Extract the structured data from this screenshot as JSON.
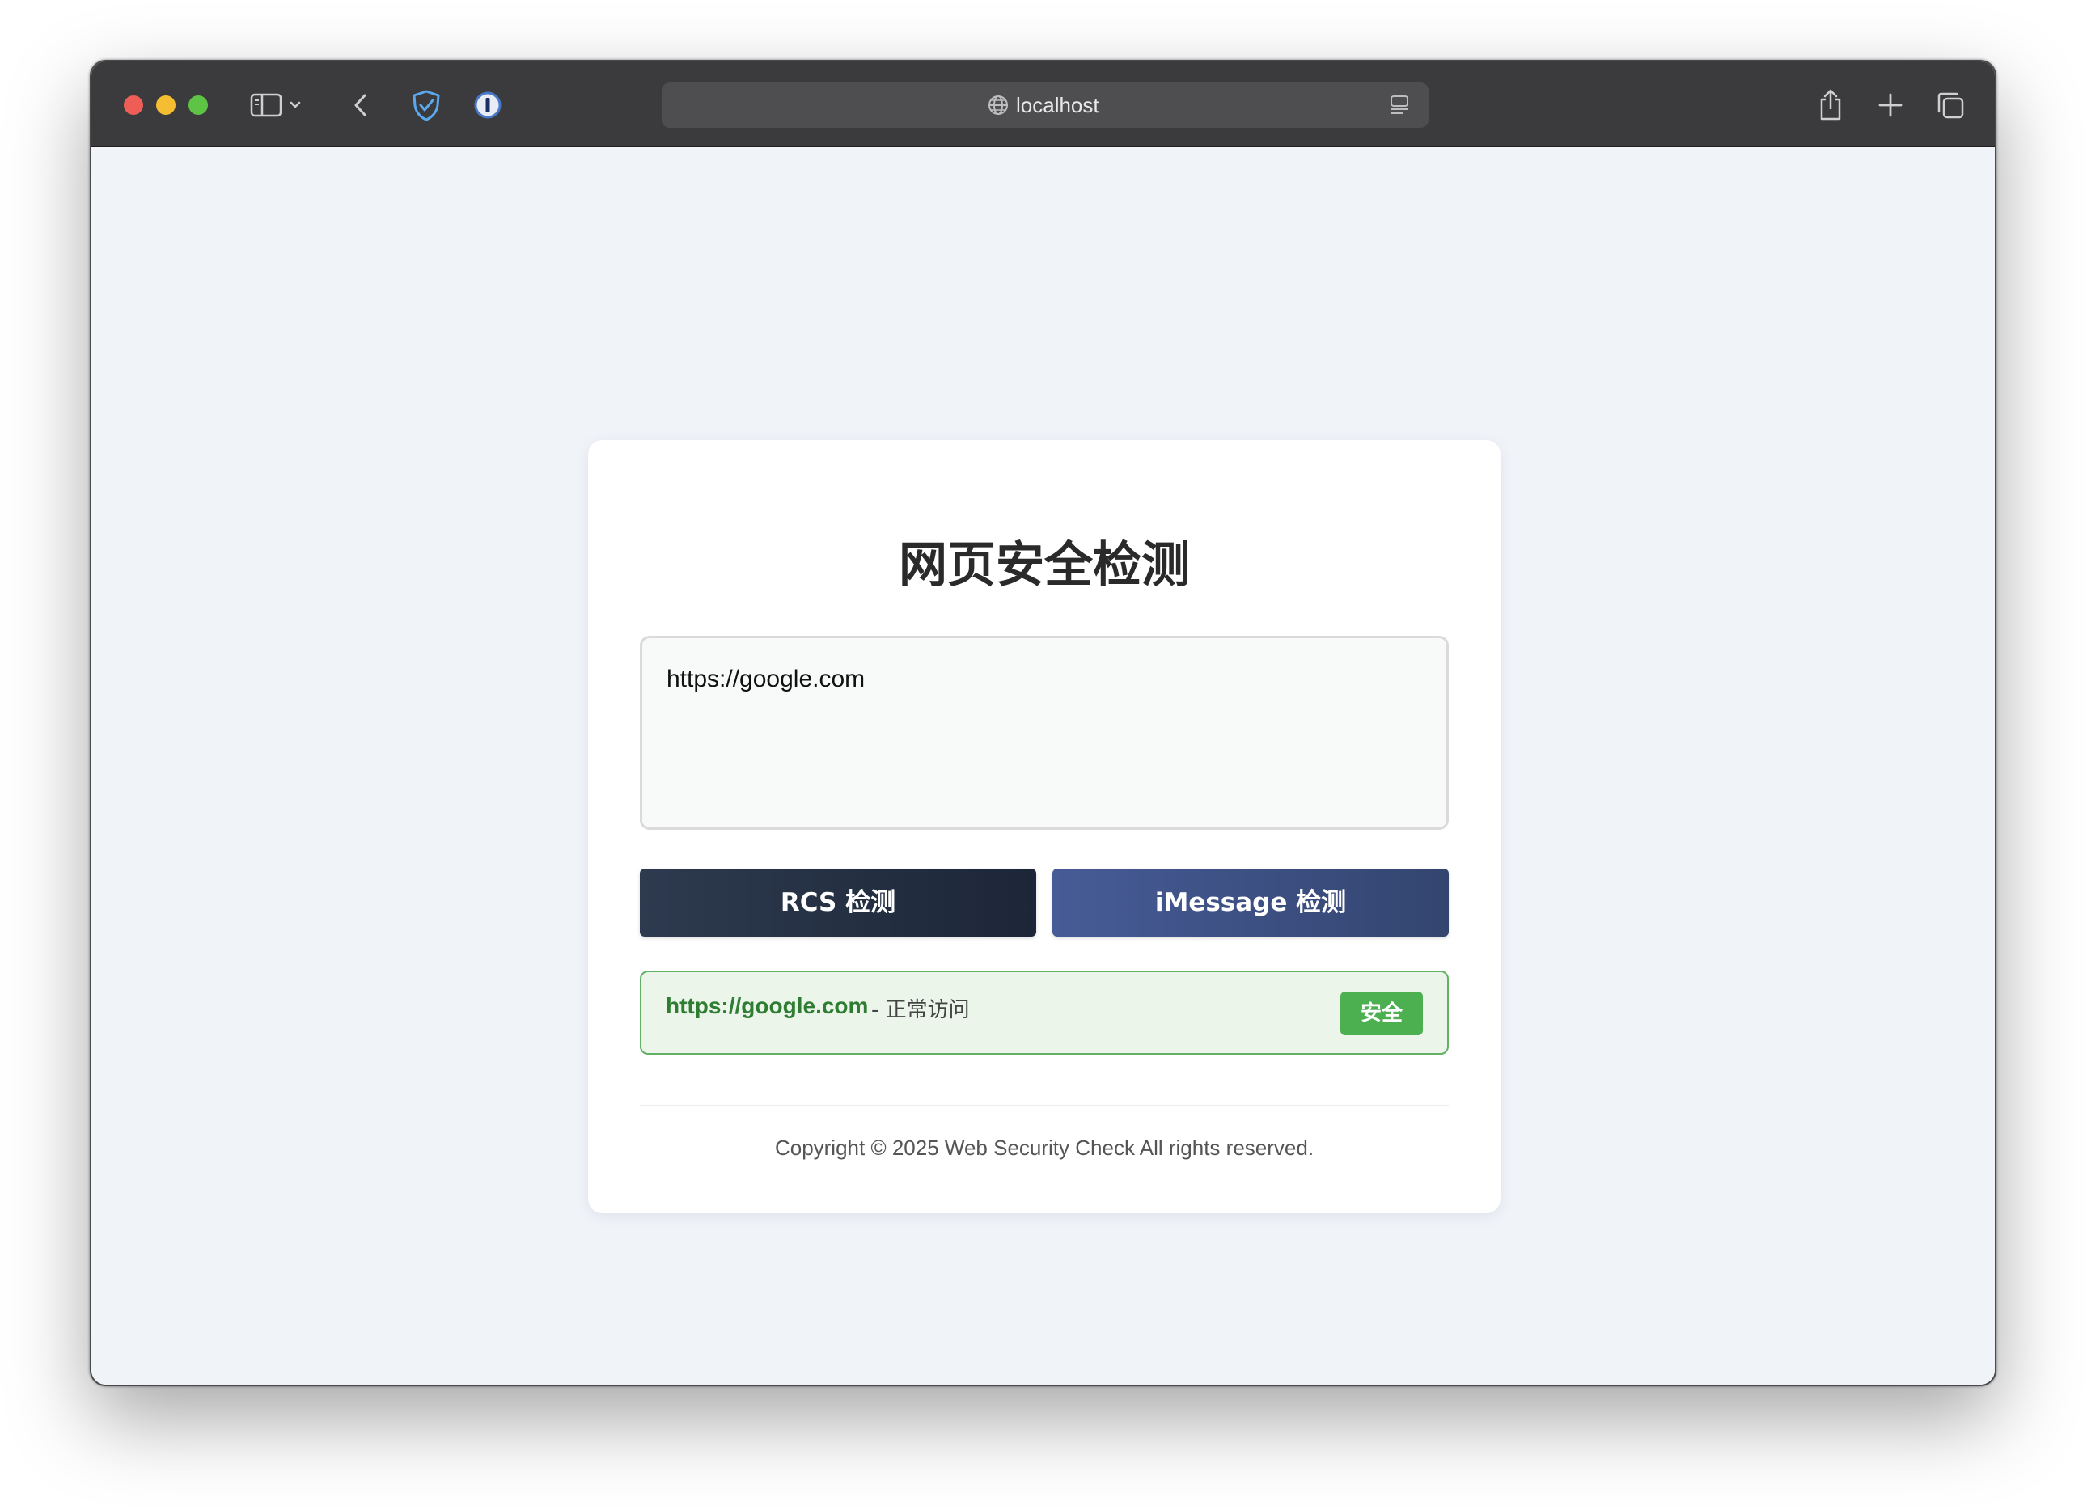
{
  "browser": {
    "url": "localhost"
  },
  "page": {
    "title": "网页安全检测",
    "input_value": "https://google.com",
    "buttons": {
      "rcs": "RCS 检测",
      "imessage": "iMessage 检测"
    },
    "result": {
      "url": "https://google.com",
      "description": "- 正常访问",
      "badge": "安全"
    },
    "footer": "Copyright © 2025 Web Security Check All rights reserved."
  },
  "colors": {
    "safe_green": "#4caf50",
    "rcs_button": "#2d3a4f",
    "imessage_button": "#475b97"
  }
}
